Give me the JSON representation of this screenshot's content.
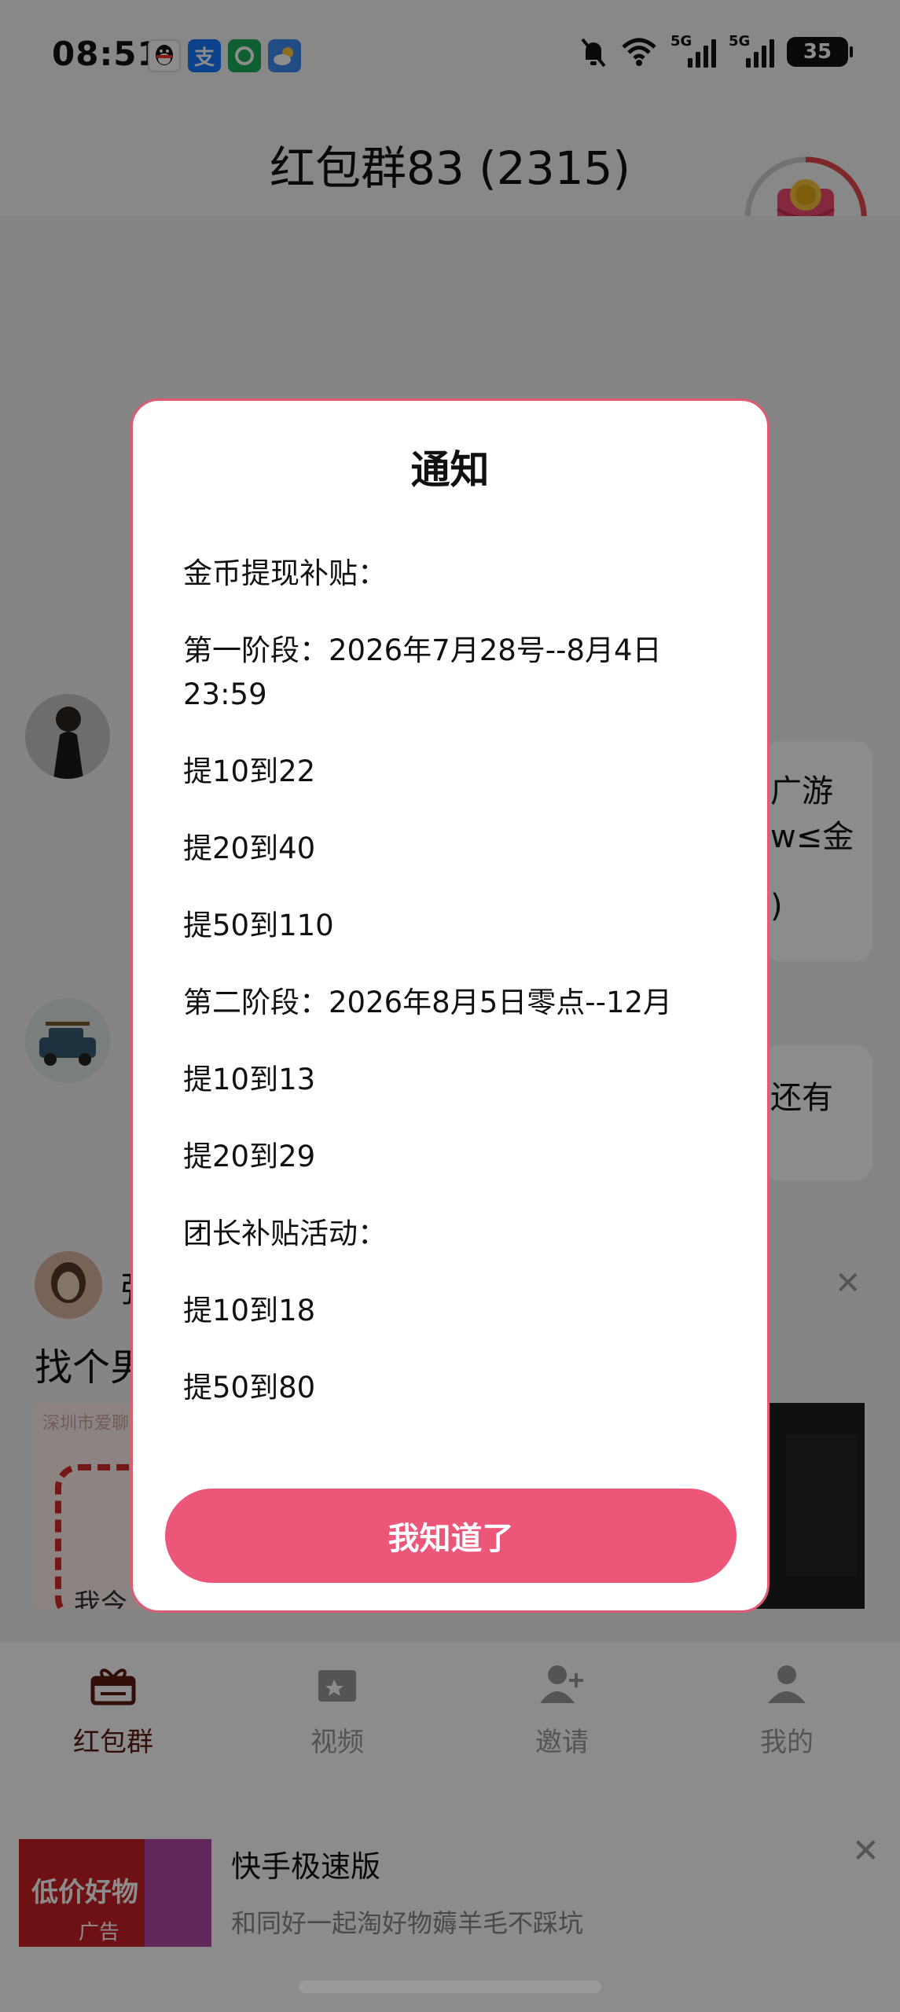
{
  "status_bar": {
    "time": "08:51",
    "battery": "35",
    "signal_1": "5G",
    "signal_2": "5G",
    "app_icons": [
      "qq-icon",
      "alipay-icon",
      "wechat-icon",
      "weather-icon"
    ]
  },
  "header": {
    "title": "红包群83 (2315)"
  },
  "chat": {
    "message_1_fragments": [
      "广游",
      "w≤金",
      ")"
    ],
    "message_2_fragments": [
      "还有"
    ]
  },
  "feed": {
    "poster_initial": "张",
    "post_text": "找个男",
    "image_caption": "深圳市爱聊",
    "image_mark": "我",
    "image_sub": "我今"
  },
  "dialog": {
    "title": "通知",
    "lines": [
      "金币提现补贴：",
      "第一阶段：2026年7月28号--8月4日 23:59",
      "提10到22",
      "提20到40",
      "提50到110",
      "第二阶段：2026年8月5日零点--12月",
      "提10到13",
      "提20到29",
      "团长补贴活动：",
      "提10到18",
      "提50到80"
    ],
    "confirm_label": "我知道了"
  },
  "bottom_nav": {
    "items": [
      {
        "label": "红包群",
        "icon": "gift-icon",
        "active": true
      },
      {
        "label": "视频",
        "icon": "video-icon",
        "active": false
      },
      {
        "label": "邀请",
        "icon": "invite-user-icon",
        "active": false
      },
      {
        "label": "我的",
        "icon": "profile-icon",
        "active": false
      }
    ]
  },
  "ad": {
    "title": "快手极速版",
    "subtitle": "和同好一起淘好物薅羊毛不踩坑",
    "thumb_text": "低价好物",
    "thumb_tag": "广告"
  },
  "colors": {
    "accent": "#eb5679",
    "dialog_border": "#e05a72",
    "nav_active": "#5b1a12"
  }
}
